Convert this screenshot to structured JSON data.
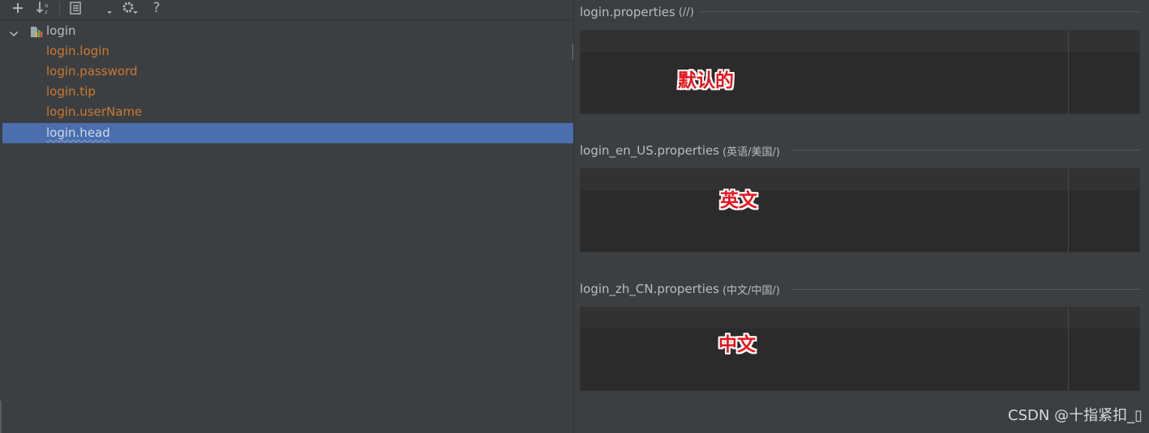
{
  "toolbar": {
    "buttons": [
      {
        "name": "add-icon"
      },
      {
        "name": "sort-alphabetically-icon"
      },
      {
        "name": "group-by-icon"
      },
      {
        "name": "dropdown-arrow-icon"
      },
      {
        "name": "settings-gear-icon"
      },
      {
        "name": "help-icon"
      }
    ],
    "help_label": "?"
  },
  "tree": {
    "root": {
      "label": "login",
      "icon": "resource-bundle-icon",
      "expanded": true
    },
    "keys": [
      {
        "label": "login.login",
        "selected": false
      },
      {
        "label": "login.password",
        "selected": false
      },
      {
        "label": "login.tip",
        "selected": false
      },
      {
        "label": "login.userName",
        "selected": false
      },
      {
        "label": "login.head",
        "selected": true
      }
    ]
  },
  "sections": [
    {
      "file": "login.properties",
      "locale": "(//)",
      "value": "",
      "annotation": "默认的"
    },
    {
      "file": "login_en_US.properties",
      "locale": "(英语/美国/)",
      "value": "",
      "annotation": "英文"
    },
    {
      "file": "login_zh_CN.properties",
      "locale": "(中文/中国/)",
      "value": "",
      "annotation": "中文"
    }
  ],
  "watermark": "CSDN @十指紧扣_▯",
  "colors": {
    "background": "#3c3f41",
    "editor_background": "#2b2b2b",
    "selection": "#4b6eaf",
    "key_text": "#cc7832",
    "annotation_red": "#e8141c"
  }
}
